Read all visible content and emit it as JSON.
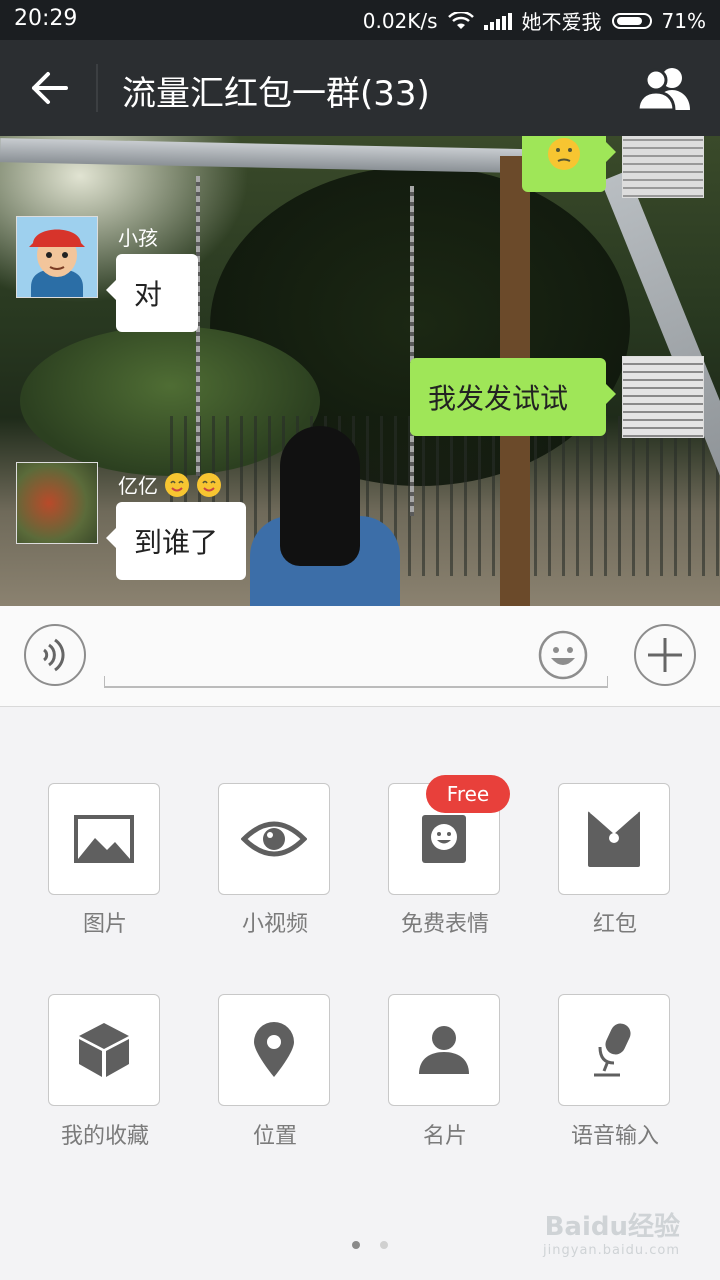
{
  "status_bar": {
    "time": "20:29",
    "net_speed": "0.02K/s",
    "carrier": "她不爱我",
    "battery": "71%"
  },
  "header": {
    "title": "流量汇红包一群(33)",
    "back_icon": "arrow-left-icon",
    "members_icon": "group-icon"
  },
  "chat": {
    "messages": [
      {
        "side": "left",
        "sender": "小孩",
        "text": "对"
      },
      {
        "side": "right",
        "text": "我发发试试"
      },
      {
        "side": "left",
        "sender": "亿亿",
        "text": "到谁了"
      }
    ]
  },
  "input_bar": {
    "voice_icon": "voice-icon",
    "emoji_icon": "emoji-icon",
    "plus_icon": "plus-icon"
  },
  "panel": {
    "badge": "Free",
    "items": [
      {
        "label": "图片",
        "icon": "image-icon"
      },
      {
        "label": "小视频",
        "icon": "eye-icon"
      },
      {
        "label": "免费表情",
        "icon": "sticker-icon"
      },
      {
        "label": "红包",
        "icon": "red-packet-icon"
      },
      {
        "label": "我的收藏",
        "icon": "cube-icon"
      },
      {
        "label": "位置",
        "icon": "location-pin-icon"
      },
      {
        "label": "名片",
        "icon": "person-icon"
      },
      {
        "label": "语音输入",
        "icon": "microphone-icon"
      }
    ]
  },
  "watermark": {
    "logo": "Baidu经验",
    "url": "jingyan.baidu.com"
  }
}
